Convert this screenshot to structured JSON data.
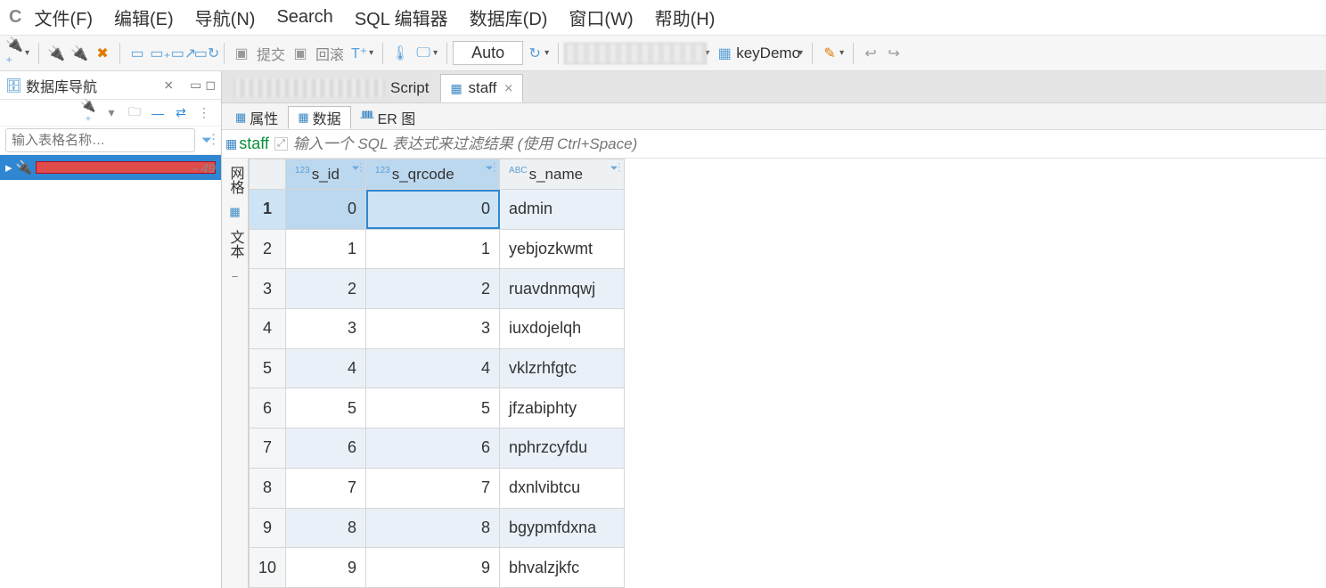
{
  "menu": {
    "file": "文件(F)",
    "edit": "编辑(E)",
    "navigate": "导航(N)",
    "search": "Search",
    "sql": "SQL 编辑器",
    "database": "数据库(D)",
    "window": "窗口(W)",
    "help": "帮助(H)"
  },
  "toolbar": {
    "commit": "提交",
    "rollback": "回滚",
    "autocommit": "Auto",
    "breadcrumb": "keyDemo"
  },
  "nav": {
    "title": "数据库导航",
    "filter_placeholder": "输入表格名称…",
    "tree_count": "- 49"
  },
  "tabs": {
    "script_label": "Script",
    "staff_label": "staff"
  },
  "subtabs": {
    "props": "属性",
    "data": "数据",
    "er": "ER 图"
  },
  "sqlrow": {
    "table_name": "staff",
    "placeholder": "输入一个 SQL 表达式来过滤结果 (使用 Ctrl+Space)"
  },
  "gutter": {
    "grid": "网格",
    "text": "文本"
  },
  "grid": {
    "columns": [
      {
        "name": "s_id",
        "type": "123"
      },
      {
        "name": "s_qrcode",
        "type": "123"
      },
      {
        "name": "s_name",
        "type": "ABC"
      }
    ],
    "rows": [
      {
        "n": 1,
        "s_id": 0,
        "s_qrcode": 0,
        "s_name": "admin"
      },
      {
        "n": 2,
        "s_id": 1,
        "s_qrcode": 1,
        "s_name": "yebjozkwmt"
      },
      {
        "n": 3,
        "s_id": 2,
        "s_qrcode": 2,
        "s_name": "ruavdnmqwj"
      },
      {
        "n": 4,
        "s_id": 3,
        "s_qrcode": 3,
        "s_name": "iuxdojelqh"
      },
      {
        "n": 5,
        "s_id": 4,
        "s_qrcode": 4,
        "s_name": "vklzrhfgtc"
      },
      {
        "n": 6,
        "s_id": 5,
        "s_qrcode": 5,
        "s_name": "jfzabiphty"
      },
      {
        "n": 7,
        "s_id": 6,
        "s_qrcode": 6,
        "s_name": "nphrzcyfdu"
      },
      {
        "n": 8,
        "s_id": 7,
        "s_qrcode": 7,
        "s_name": "dxnlvibtcu"
      },
      {
        "n": 9,
        "s_id": 8,
        "s_qrcode": 8,
        "s_name": "bgypmfdxna"
      },
      {
        "n": 10,
        "s_id": 9,
        "s_qrcode": 9,
        "s_name": "bhvalzjkfc"
      }
    ],
    "selected_row": 1,
    "selected_col": "s_qrcode"
  }
}
